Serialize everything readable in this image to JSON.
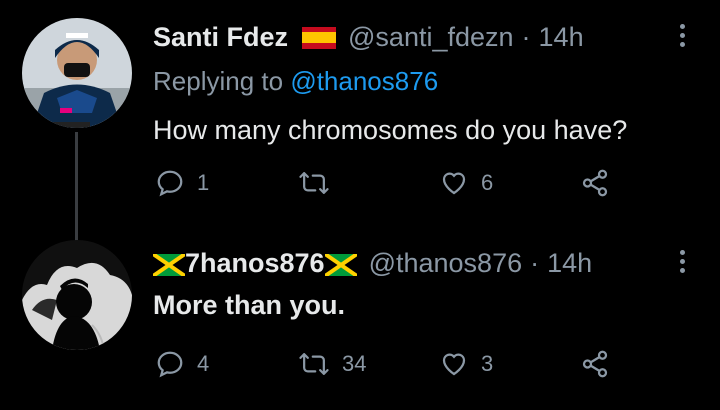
{
  "tweets": [
    {
      "display_name": "Santi Fdez",
      "handle": "@santi_fdezn",
      "separator": "·",
      "time": "14h",
      "reply_prefix": "Replying to",
      "reply_to": "@thanos876",
      "text": "How many chromosomes do you have?",
      "reply_count": "1",
      "retweet_count": "",
      "like_count": "6",
      "flag": "spain-flag-icon"
    },
    {
      "display_name": "7hanos876",
      "handle": "@thanos876",
      "separator": "·",
      "time": "14h",
      "text": "More than you.",
      "reply_count": "4",
      "retweet_count": "34",
      "like_count": "3",
      "flag": "jamaica-flag-icon"
    }
  ],
  "colors": {
    "background": "#000000",
    "text": "#e7e9ea",
    "secondary": "#8b98a5",
    "link": "#1d9bf0"
  }
}
